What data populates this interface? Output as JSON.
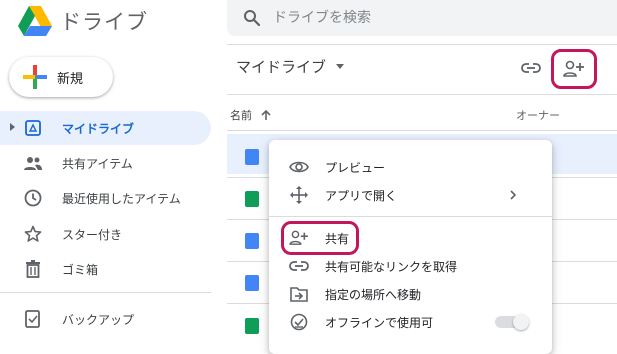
{
  "app": {
    "title": "ドライブ"
  },
  "search": {
    "placeholder": "ドライブを検索"
  },
  "sidebar": {
    "new_label": "新規",
    "items": [
      {
        "label": "マイドライブ",
        "icon": "my-drive-icon",
        "active": true
      },
      {
        "label": "共有アイテム",
        "icon": "shared-people-icon"
      },
      {
        "label": "最近使用したアイテム",
        "icon": "clock-icon"
      },
      {
        "label": "スター付き",
        "icon": "star-icon"
      },
      {
        "label": "ゴミ箱",
        "icon": "trash-icon"
      },
      {
        "label": "バックアップ",
        "icon": "backup-icon"
      }
    ]
  },
  "main": {
    "breadcrumb": "マイドライブ",
    "columns": {
      "name": "名前",
      "owner": "オーナー"
    }
  },
  "context_menu": {
    "items": [
      {
        "label": "プレビュー",
        "icon": "eye-icon"
      },
      {
        "label": "アプリで開く",
        "icon": "move-arrows-icon"
      },
      {
        "label": "共有",
        "icon": "add-person-icon"
      },
      {
        "label": "共有可能なリンクを取得",
        "icon": "link-icon"
      },
      {
        "label": "指定の場所へ移動",
        "icon": "folder-move-icon"
      },
      {
        "label": "オフラインで使用可",
        "icon": "offline-check-icon"
      }
    ]
  },
  "colors": {
    "accent": "#1a73e8",
    "highlight": "#c2185b",
    "docs_blue": "#4285f4",
    "sheets_green": "#0f9d58"
  }
}
